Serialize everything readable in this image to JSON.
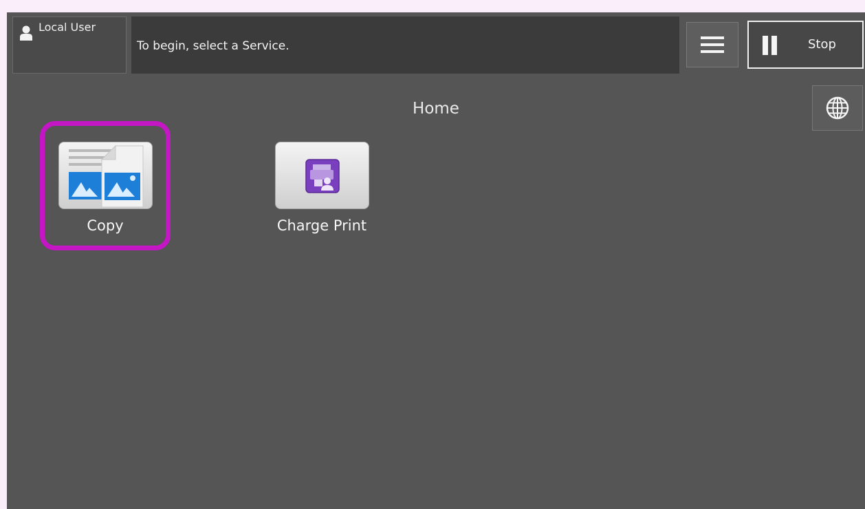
{
  "header": {
    "user_label": "Local User",
    "message": "To begin, select a Service.",
    "stop_label": "Stop"
  },
  "page": {
    "title": "Home"
  },
  "apps": [
    {
      "label": "Copy",
      "icon": "copy-icon"
    },
    {
      "label": "Charge Print",
      "icon": "charge-print-icon"
    }
  ],
  "colors": {
    "highlight": "#c516c5",
    "screen_bg": "#555555",
    "accent_purple": "#7a3fbf",
    "copy_blue": "#1e7fd8"
  }
}
